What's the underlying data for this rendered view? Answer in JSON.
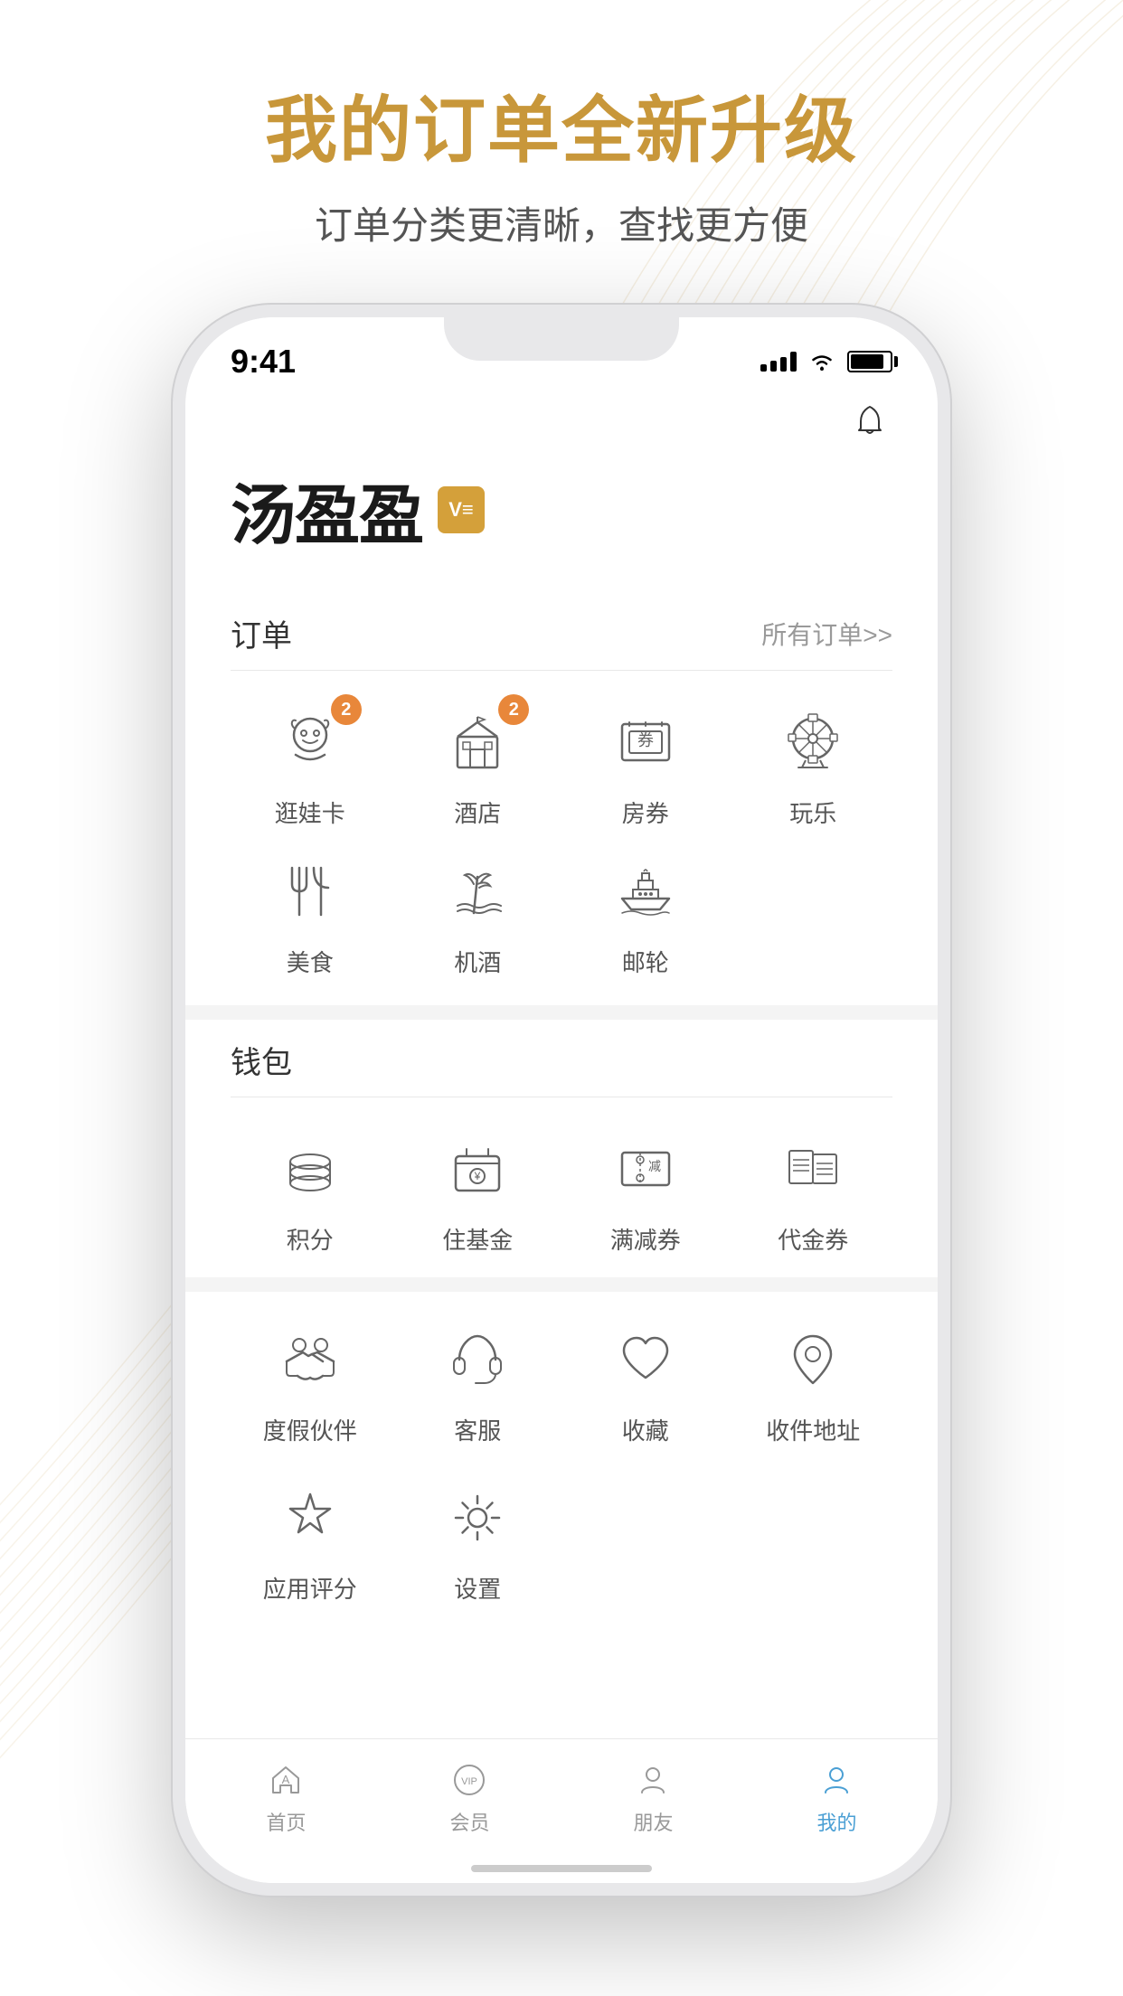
{
  "page": {
    "background_color": "#ffffff"
  },
  "headline": {
    "main": "我的订单全新升级",
    "sub": "订单分类更清晰，查找更方便"
  },
  "status_bar": {
    "time": "9:41",
    "signal": "●●●●",
    "wifi": "wifi",
    "battery": "battery"
  },
  "brand": {
    "name": "汤盈盈",
    "vip_label": "V≡"
  },
  "orders_section": {
    "title": "订单",
    "link": "所有订单>>",
    "items": [
      {
        "id": "erwa",
        "label": "逛娃卡",
        "badge": "2",
        "icon": "baby"
      },
      {
        "id": "hotel",
        "label": "酒店",
        "badge": "2",
        "icon": "hotel"
      },
      {
        "id": "roomcoupon",
        "label": "房券",
        "badge": null,
        "icon": "coupon"
      },
      {
        "id": "play",
        "label": "玩乐",
        "badge": null,
        "icon": "ferris"
      },
      {
        "id": "food",
        "label": "美食",
        "badge": null,
        "icon": "food"
      },
      {
        "id": "airhotel",
        "label": "机酒",
        "badge": null,
        "icon": "resort"
      },
      {
        "id": "cruise",
        "label": "邮轮",
        "badge": null,
        "icon": "cruise"
      }
    ]
  },
  "wallet_section": {
    "title": "钱包",
    "items": [
      {
        "id": "points",
        "label": "积分",
        "icon": "stack"
      },
      {
        "id": "jijin",
        "label": "住基金",
        "icon": "safe"
      },
      {
        "id": "discount",
        "label": "满减券",
        "icon": "ticket"
      },
      {
        "id": "voucher",
        "label": "代金券",
        "icon": "voucher"
      }
    ]
  },
  "services_section": {
    "items": [
      {
        "id": "partner",
        "label": "度假伙伴",
        "icon": "handshake"
      },
      {
        "id": "service",
        "label": "客服",
        "icon": "headset"
      },
      {
        "id": "collect",
        "label": "收藏",
        "icon": "heart"
      },
      {
        "id": "address",
        "label": "收件地址",
        "icon": "location"
      },
      {
        "id": "rating",
        "label": "应用评分",
        "icon": "star"
      },
      {
        "id": "settings",
        "label": "设置",
        "icon": "gear"
      }
    ]
  },
  "bottom_nav": {
    "items": [
      {
        "id": "home",
        "label": "首页",
        "active": false,
        "icon": "home-nav"
      },
      {
        "id": "vip",
        "label": "会员",
        "active": false,
        "icon": "vip-nav"
      },
      {
        "id": "friends",
        "label": "朋友",
        "active": false,
        "icon": "friends-nav"
      },
      {
        "id": "mine",
        "label": "我的",
        "active": true,
        "icon": "mine-nav"
      }
    ]
  }
}
